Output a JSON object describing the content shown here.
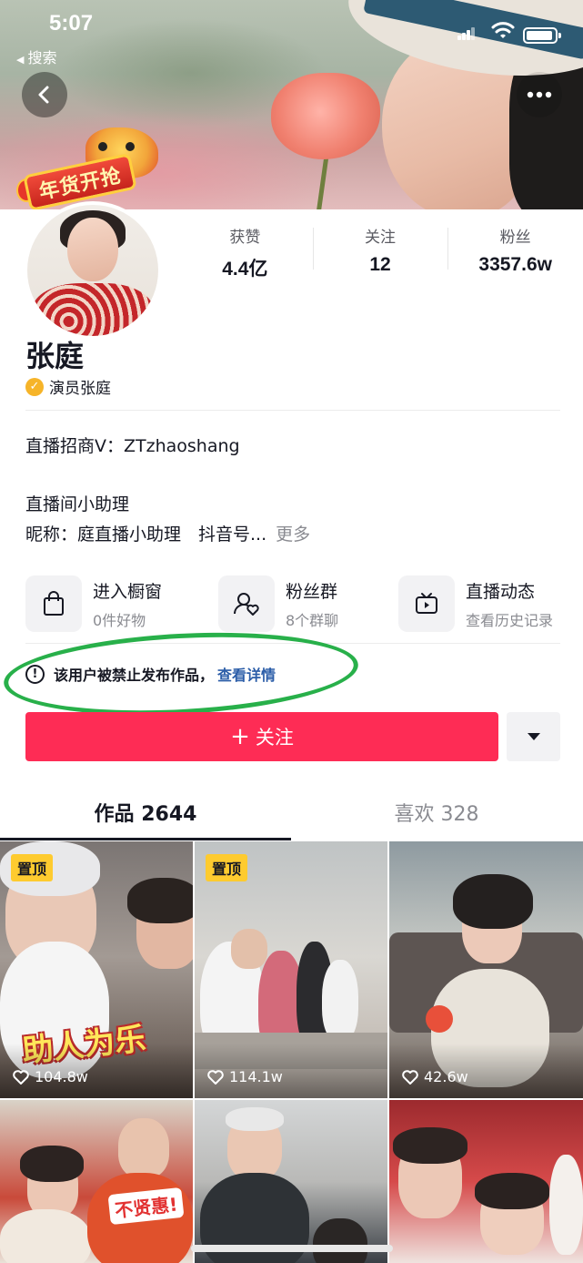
{
  "status_bar": {
    "time": "5:07",
    "back_app": "搜索"
  },
  "promo_badge": "年货开抢",
  "stats": [
    {
      "label": "获赞",
      "value": "4.4亿"
    },
    {
      "label": "关注",
      "value": "12"
    },
    {
      "label": "粉丝",
      "value": "3357.6w"
    }
  ],
  "profile": {
    "name": "张庭",
    "verified_label": "演员张庭",
    "bio_line1": "直播招商V：ZTzhaoshang",
    "bio_line2": "直播间小助理",
    "bio_line3": "昵称：庭直播小助理　抖音号...",
    "more_label": "更多"
  },
  "shortcuts": [
    {
      "title": "进入橱窗",
      "subtitle": "0件好物",
      "icon": "shopping-bag-icon"
    },
    {
      "title": "粉丝群",
      "subtitle": "8个群聊",
      "icon": "fan-group-icon"
    },
    {
      "title": "直播动态",
      "subtitle": "查看历史记录",
      "icon": "live-tv-icon"
    }
  ],
  "notice": {
    "text": "该用户被禁止发布作品，",
    "link": "查看详情"
  },
  "follow_button": {
    "plus": "+",
    "label": "关注"
  },
  "tabs": [
    {
      "label": "作品 2644",
      "active": true
    },
    {
      "label": "喜欢 328",
      "active": false
    }
  ],
  "videos": [
    {
      "pinned": true,
      "pin_label": "置顶",
      "likes": "104.8w",
      "overlay_text": "助人为乐"
    },
    {
      "pinned": true,
      "pin_label": "置顶",
      "likes": "114.1w"
    },
    {
      "pinned": false,
      "likes": "42.6w"
    },
    {
      "pinned": false,
      "overlay_text": "不贤惠!"
    },
    {
      "pinned": false
    },
    {
      "pinned": false
    }
  ],
  "colors": {
    "accent": "#fe2c55",
    "link": "#2b5da8",
    "pin": "#fecb2f",
    "annotation": "#28b04a"
  }
}
